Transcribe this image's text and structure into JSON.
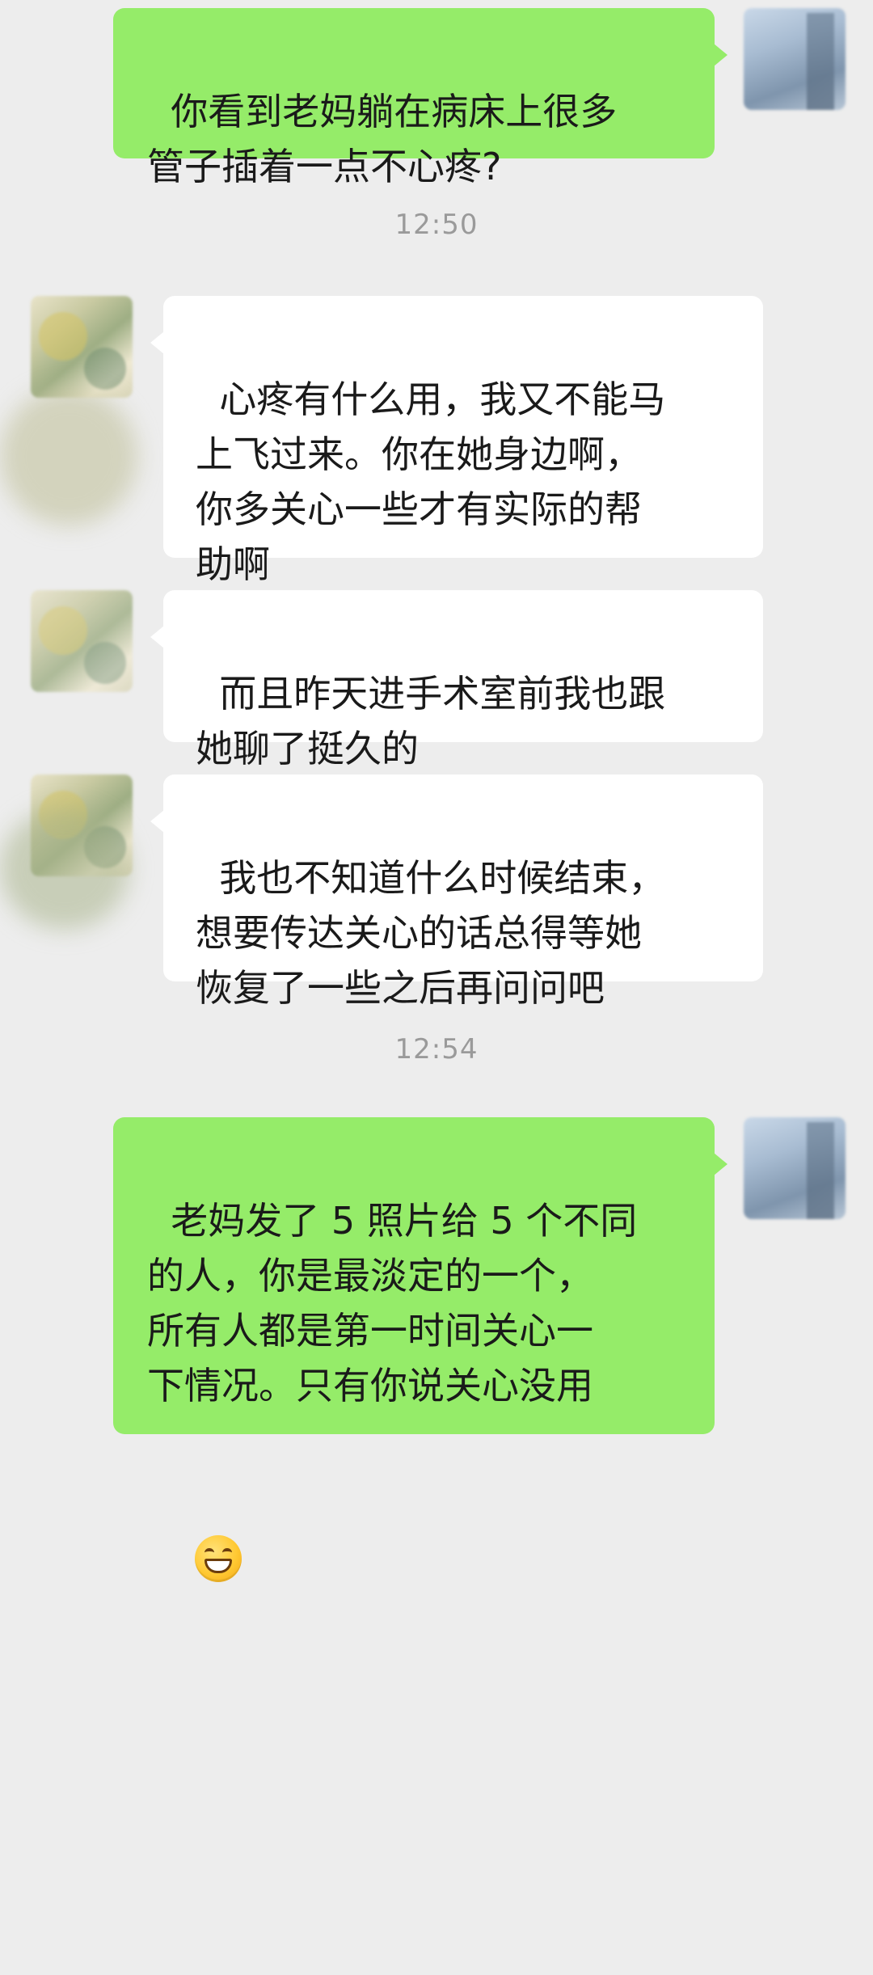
{
  "messages": [
    {
      "sender": "self",
      "text": "你看到老妈躺在病床上很多\n管子插着一点不心疼?"
    },
    {
      "sender": "other",
      "text": "心疼有什么用，我又不能马\n上飞过来。你在她身边啊，\n你多关心一些才有实际的帮\n助啊"
    },
    {
      "sender": "other",
      "text": "而且昨天进手术室前我也跟\n她聊了挺久的"
    },
    {
      "sender": "other",
      "text": "我也不知道什么时候结束，\n想要传达关心的话总得等她\n恢复了一些之后再问问吧"
    },
    {
      "sender": "self",
      "text": "老妈发了 5 照片给 5 个不同\n的人，你是最淡定的一个，\n所有人都是第一时间关心一\n下情况。只有你说关心没用",
      "emoji": "grinning-face"
    }
  ],
  "timestamps": [
    "12:50",
    "12:54"
  ],
  "colors": {
    "background": "#ededed",
    "self_bubble": "#95ec69",
    "other_bubble": "#ffffff",
    "timestamp_text": "#9a9a9a"
  }
}
